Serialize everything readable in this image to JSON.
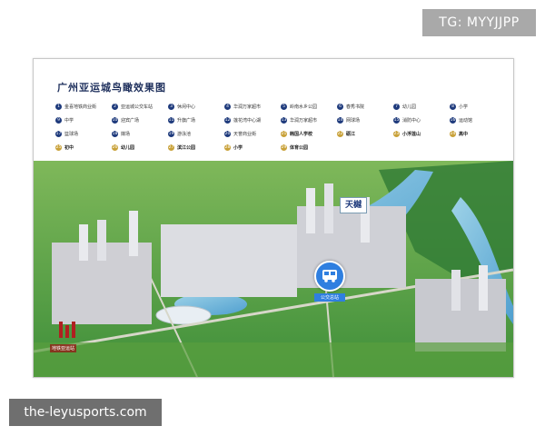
{
  "watermark_top": "TG: MYYJJPP",
  "watermark_bottom": "the-leyusports.com",
  "map": {
    "title": "广州亚运城鸟瞰效果图",
    "landmark_label": "天樾",
    "bus_station_label": "公交总站",
    "logo_text": "地铁亚运站",
    "colors": {
      "navy": "#1e3a7c",
      "gold": "#c9a23a",
      "river": "#6fb6d8",
      "green": "#3f8f3a",
      "bus_blue": "#2f7fe0"
    }
  },
  "legend": [
    {
      "num": "1",
      "label": "金喜地铁商业街",
      "style": "blue"
    },
    {
      "num": "2",
      "label": "亚运城公交车站",
      "style": "blue"
    },
    {
      "num": "3",
      "label": "休闲中心",
      "style": "blue"
    },
    {
      "num": "4",
      "label": "华润万家超市",
      "style": "blue"
    },
    {
      "num": "5",
      "label": "岭南水乡公园",
      "style": "blue"
    },
    {
      "num": "6",
      "label": "春秀书院",
      "style": "blue"
    },
    {
      "num": "7",
      "label": "幼儿园",
      "style": "blue"
    },
    {
      "num": "8",
      "label": "小学",
      "style": "blue"
    },
    {
      "num": "9",
      "label": "中学",
      "style": "blue"
    },
    {
      "num": "10",
      "label": "迎宾广场",
      "style": "blue"
    },
    {
      "num": "11",
      "label": "升旗广场",
      "style": "blue"
    },
    {
      "num": "12",
      "label": "莲花湾中心湖",
      "style": "blue"
    },
    {
      "num": "13",
      "label": "华润万家超市",
      "style": "blue"
    },
    {
      "num": "14",
      "label": "网球场",
      "style": "blue"
    },
    {
      "num": "15",
      "label": "消防中心",
      "style": "blue"
    },
    {
      "num": "16",
      "label": "运动馆",
      "style": "blue"
    },
    {
      "num": "17",
      "label": "篮球场",
      "style": "blue"
    },
    {
      "num": "18",
      "label": "媒场",
      "style": "blue"
    },
    {
      "num": "19",
      "label": "游泳池",
      "style": "blue"
    },
    {
      "num": "20",
      "label": "天誉商业街",
      "style": "blue"
    },
    {
      "num": "21",
      "label": "韩国人学校",
      "style": "gold"
    },
    {
      "num": "22",
      "label": "砺江",
      "style": "gold"
    },
    {
      "num": "23",
      "label": "小浮莲山",
      "style": "gold"
    },
    {
      "num": "24",
      "label": "高中",
      "style": "gold"
    },
    {
      "num": "25",
      "label": "初中",
      "style": "gold"
    },
    {
      "num": "26",
      "label": "幼儿园",
      "style": "gold"
    },
    {
      "num": "27",
      "label": "滨江公园",
      "style": "gold"
    },
    {
      "num": "28",
      "label": "小学",
      "style": "gold"
    },
    {
      "num": "29",
      "label": "体育公园",
      "style": "gold"
    }
  ]
}
